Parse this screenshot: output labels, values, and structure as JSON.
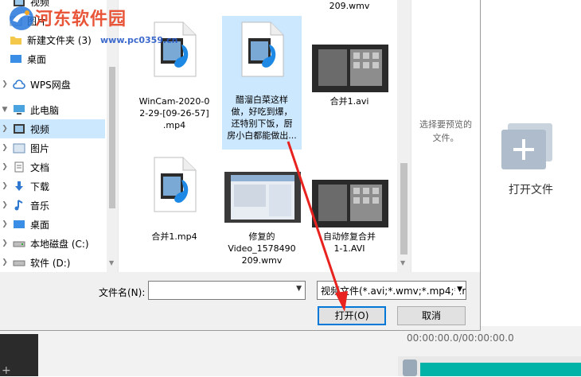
{
  "app": {
    "open_file_label": "打开文件",
    "timecode": "00:00:00.0/00:00:00.0",
    "add_glyph": "+"
  },
  "dialog": {
    "nav": {
      "items": [
        {
          "label": "视频",
          "icon": "video-folder-icon"
        },
        {
          "label": "图片",
          "icon": "picture-folder-icon"
        },
        {
          "label": "新建文件夹 (3)",
          "icon": "folder-icon"
        },
        {
          "label": "桌面",
          "icon": "desktop-icon"
        },
        {
          "label": "WPS网盘",
          "icon": "cloud-icon"
        },
        {
          "label": "此电脑",
          "icon": "computer-icon"
        },
        {
          "label": "视频",
          "icon": "video-folder-icon"
        },
        {
          "label": "图片",
          "icon": "picture-folder-icon"
        },
        {
          "label": "文档",
          "icon": "document-folder-icon"
        },
        {
          "label": "下载",
          "icon": "download-icon"
        },
        {
          "label": "音乐",
          "icon": "music-icon"
        },
        {
          "label": "桌面",
          "icon": "desktop-icon"
        },
        {
          "label": "本地磁盘 (C:)",
          "icon": "drive-icon"
        },
        {
          "label": "软件 (D:)",
          "icon": "drive-icon"
        }
      ]
    },
    "files": [
      {
        "name": "209.wmv",
        "kind": "partial"
      },
      {
        "name": "WinCam-2020-02-29-[09-26-57].mp4",
        "lines": [
          "WinCam-2020-0",
          "2-29-[09-26-57]",
          ".mp4"
        ],
        "kind": "media"
      },
      {
        "name": "醋溜白菜这样做，好吃到爆，还特别下饭，厨房小白都能做出...",
        "lines": [
          "醋溜白菜这样",
          "做，好吃到爆，",
          "还特别下饭，厨",
          "房小白都能做出..."
        ],
        "kind": "media"
      },
      {
        "name": "合并1.avi",
        "lines": [
          "合并1.avi"
        ],
        "kind": "video"
      },
      {
        "name": "合并1.mp4",
        "lines": [
          "合并1.mp4"
        ],
        "kind": "media"
      },
      {
        "name": "修复的Video_1578490209.wmv",
        "lines": [
          "修复的",
          "Video_1578490",
          "209.wmv"
        ],
        "kind": "video"
      },
      {
        "name": "自动修复合并1-1.AVI",
        "lines": [
          "自动修复合并",
          "1-1.AVI"
        ],
        "kind": "video"
      }
    ],
    "preview_text_1": "选择要预览的",
    "preview_text_2": "文件。",
    "filename_label": "文件名(N):",
    "filename_value": "",
    "filetype_value": "视频文件(*.avi;*.wmv;*.mp4;*.r",
    "open_button": "打开(O)",
    "cancel_button": "取消"
  },
  "watermark": {
    "title": "河东软件园",
    "url": "www.pc0359.cn"
  },
  "colors": {
    "selection": "#cce8ff",
    "primary_border": "#0078d7",
    "annotation": "#e8231f",
    "timeline_track": "#00b3a6"
  }
}
